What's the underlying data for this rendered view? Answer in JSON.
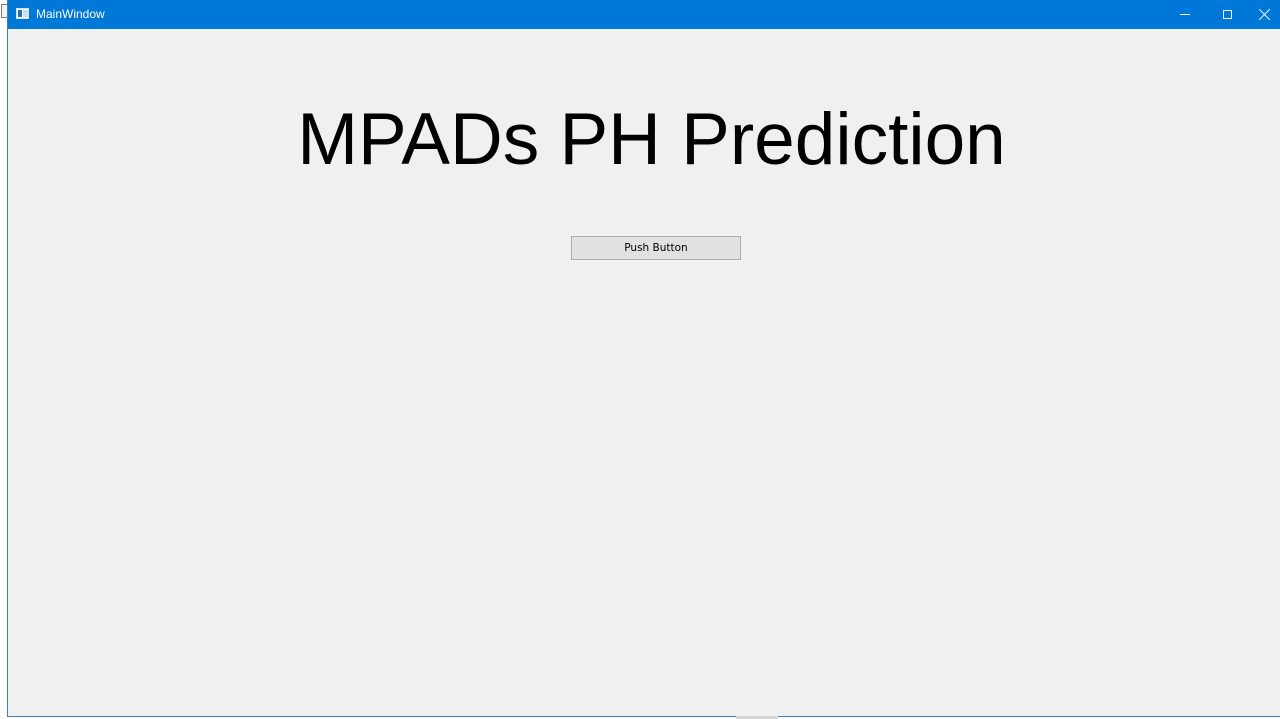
{
  "window": {
    "title": "MainWindow",
    "app_icon": "app-window-icon",
    "controls": {
      "minimize_icon": "minimize-icon",
      "maximize_icon": "maximize-icon",
      "close_icon": "close-icon"
    },
    "titlebar_color": "#0078d7",
    "background_color": "#f0f0f0"
  },
  "main": {
    "heading": "MPADs PH Prediction",
    "push_button_label": "Push Button"
  }
}
